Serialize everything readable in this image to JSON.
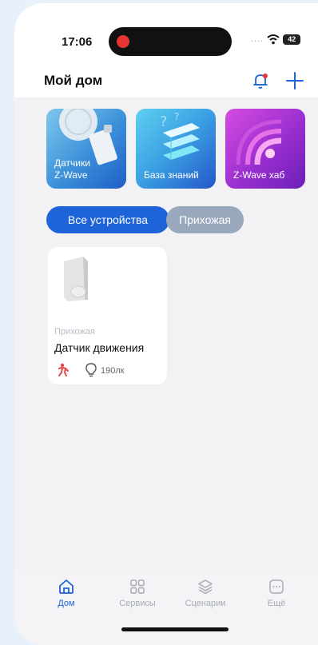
{
  "status": {
    "time": "17:06",
    "battery": "42",
    "signal": "...."
  },
  "header": {
    "title": "Мой дом"
  },
  "cards": [
    {
      "line1": "Датчики",
      "line2": "Z-Wave"
    },
    {
      "line1": "База знаний",
      "line2": ""
    },
    {
      "line1": "Z-Wave хаб",
      "line2": ""
    }
  ],
  "filters": [
    {
      "label": "Все устройства",
      "selected": true
    },
    {
      "label": "Прихожая",
      "selected": false
    }
  ],
  "device": {
    "room": "Прихожая",
    "name": "Датчик движения",
    "lux": "190лк"
  },
  "tabs": [
    {
      "label": "Дом"
    },
    {
      "label": "Сервисы"
    },
    {
      "label": "Сценарии"
    },
    {
      "label": "Ещё"
    }
  ],
  "colors": {
    "accent": "#1e64d8",
    "bell_dot": "#e53535"
  }
}
